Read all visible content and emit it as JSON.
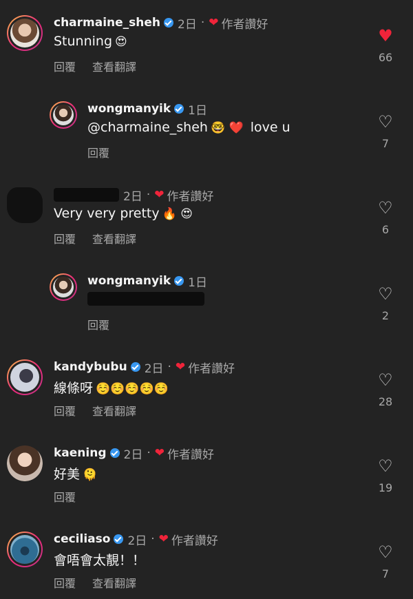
{
  "labels": {
    "reply": "回覆",
    "translate": "查看翻譯",
    "author_liked": "作者讚好"
  },
  "comments": [
    {
      "username": "charmaine_sheh",
      "time": "2日",
      "text": "Stunning",
      "emoji": "😍",
      "likes": "66",
      "liked_by_viewer": true
    },
    {
      "username": "wongmanyik",
      "time": "1日",
      "text": "@charmaine_sheh",
      "emoji": "🤓 ❤️",
      "text_after": "love u",
      "likes": "7"
    },
    {
      "username": "",
      "time": "2日",
      "text": "Very very pretty",
      "emoji": "🔥 😍",
      "likes": "6"
    },
    {
      "username": "wongmanyik",
      "time": "1日",
      "text": "",
      "likes": "2"
    },
    {
      "username": "kandybubu",
      "time": "2日",
      "text": "線條呀",
      "emoji": "☺️☺️☺️☺️☺️",
      "likes": "28"
    },
    {
      "username": "kaening",
      "time": "2日",
      "text": "好美",
      "emoji": "🫠",
      "likes": "19"
    },
    {
      "username": "ceciliaso",
      "time": "2日",
      "text": "會唔會太靚！！",
      "likes": "7"
    }
  ],
  "colors": {
    "background": "#232323",
    "heart_red": "#f0243a",
    "verified_blue": "#3897f0",
    "secondary_text": "#a8a8a8"
  },
  "icons": {
    "like": "heart-icon",
    "verified": "verified-badge-icon"
  }
}
